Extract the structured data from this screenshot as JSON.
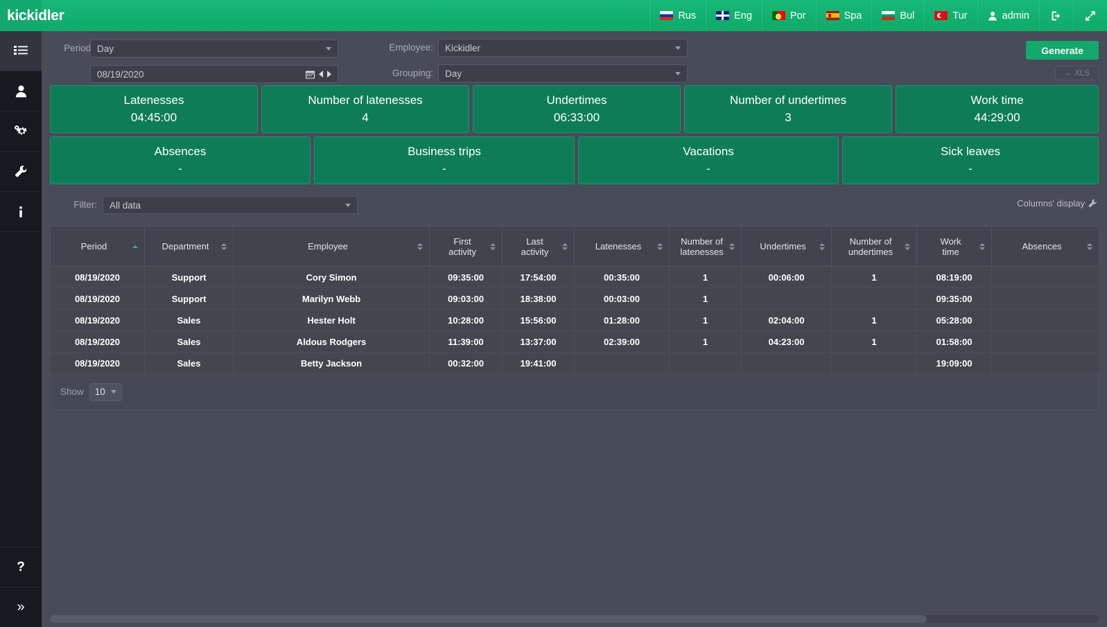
{
  "app": {
    "logo": "kickidler"
  },
  "topnav": {
    "languages": [
      {
        "code": "rus",
        "label": "Rus"
      },
      {
        "code": "eng",
        "label": "Eng"
      },
      {
        "code": "por",
        "label": "Por"
      },
      {
        "code": "spa",
        "label": "Spa"
      },
      {
        "code": "bul",
        "label": "Bul"
      },
      {
        "code": "tur",
        "label": "Tur"
      }
    ],
    "user": "admin",
    "logout_icon": "logout-icon",
    "fullscreen_icon": "fullscreen-icon"
  },
  "sidebar": {
    "items": [
      {
        "icon": "list-icon",
        "name": "reports"
      },
      {
        "icon": "user-icon",
        "name": "employees"
      },
      {
        "icon": "gears-icon",
        "name": "settings"
      },
      {
        "icon": "wrench-icon",
        "name": "tools"
      },
      {
        "icon": "info-icon",
        "name": "info"
      }
    ],
    "bottom": [
      {
        "icon": "help-icon",
        "name": "help",
        "glyph": "?"
      },
      {
        "icon": "expand-icon",
        "name": "expand",
        "glyph": "»"
      }
    ]
  },
  "controls": {
    "period_label": "Period:",
    "period_value": "Day",
    "date_value": "08/19/2020",
    "employee_label": "Employee:",
    "employee_value": "Kickidler",
    "grouping_label": "Grouping:",
    "grouping_value": "Day",
    "generate_label": "Generate",
    "xls_label": "XLS",
    "xls_arrow": "→"
  },
  "kpi": {
    "row1": [
      {
        "title": "Latenesses",
        "value": "04:45:00"
      },
      {
        "title": "Number of latenesses",
        "value": "4"
      },
      {
        "title": "Undertimes",
        "value": "06:33:00"
      },
      {
        "title": "Number of undertimes",
        "value": "3"
      },
      {
        "title": "Work time",
        "value": "44:29:00"
      }
    ],
    "row2": [
      {
        "title": "Absences",
        "value": "-"
      },
      {
        "title": "Business trips",
        "value": "-"
      },
      {
        "title": "Vacations",
        "value": "-"
      },
      {
        "title": "Sick leaves",
        "value": "-"
      }
    ]
  },
  "filter": {
    "label": "Filter:",
    "value": "All data",
    "columns_display": "Columns' display"
  },
  "table": {
    "columns": [
      {
        "label": "Period",
        "sort": "asc"
      },
      {
        "label": "Department",
        "sort": "none"
      },
      {
        "label": "Employee",
        "sort": "none"
      },
      {
        "label": "First\nactivity",
        "sort": "none"
      },
      {
        "label": "Last\nactivity",
        "sort": "none"
      },
      {
        "label": "Latenesses",
        "sort": "none"
      },
      {
        "label": "Number of\nlatenesses",
        "sort": "none"
      },
      {
        "label": "Undertimes",
        "sort": "none"
      },
      {
        "label": "Number of\nundertimes",
        "sort": "none"
      },
      {
        "label": "Work\ntime",
        "sort": "none"
      },
      {
        "label": "Absences",
        "sort": "none"
      }
    ],
    "rows": [
      [
        "08/19/2020",
        "Support",
        "Cory Simon",
        "09:35:00",
        "17:54:00",
        "00:35:00",
        "1",
        "00:06:00",
        "1",
        "08:19:00",
        ""
      ],
      [
        "08/19/2020",
        "Support",
        "Marilyn Webb",
        "09:03:00",
        "18:38:00",
        "00:03:00",
        "1",
        "",
        "",
        "09:35:00",
        ""
      ],
      [
        "08/19/2020",
        "Sales",
        "Hester Holt",
        "10:28:00",
        "15:56:00",
        "01:28:00",
        "1",
        "02:04:00",
        "1",
        "05:28:00",
        ""
      ],
      [
        "08/19/2020",
        "Sales",
        "Aldous Rodgers",
        "11:39:00",
        "13:37:00",
        "02:39:00",
        "1",
        "04:23:00",
        "1",
        "01:58:00",
        ""
      ],
      [
        "08/19/2020",
        "Sales",
        "Betty Jackson",
        "00:32:00",
        "19:41:00",
        "",
        "",
        "",
        "",
        "19:09:00",
        ""
      ]
    ]
  },
  "footer": {
    "show_label": "Show",
    "show_value": "10"
  },
  "colors": {
    "brand": "#13a86d",
    "kpi": "#0e7d57",
    "bg": "#484b58"
  }
}
